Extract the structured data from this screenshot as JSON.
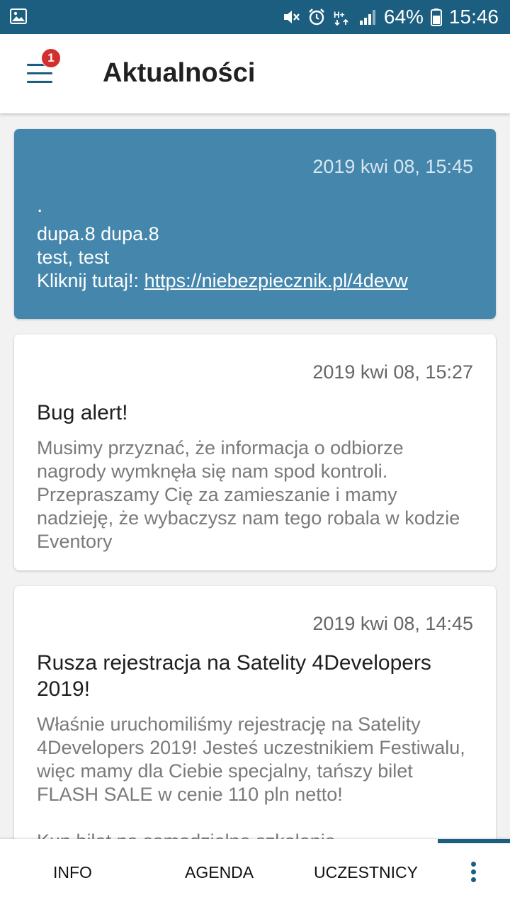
{
  "status_bar": {
    "battery": "64%",
    "time": "15:46",
    "icons": [
      "gallery-icon",
      "mute-icon",
      "alarm-icon",
      "hplus-network-icon",
      "signal-icon",
      "battery-icon"
    ]
  },
  "app_bar": {
    "title": "Aktualności",
    "menu_badge": "1"
  },
  "news": [
    {
      "date": "2019 kwi 08, 15:45",
      "title": ".",
      "lines": [
        "dupa.8 dupa.8",
        "test, test"
      ],
      "link_prefix": "Kliknij tutaj!: ",
      "link_text": "https://niebezpiecznik.pl/4devw",
      "highlighted": true
    },
    {
      "date": "2019 kwi 08, 15:27",
      "title": "Bug alert!",
      "body": "Musimy przyznać, że informacja o odbiorze nagrody wymknęła się nam spod kontroli. Przepraszamy Cię za zamieszanie i mamy nadzieję, że wybaczysz nam tego robala w kodzie Eventory"
    },
    {
      "date": "2019 kwi 08, 14:45",
      "title": "Rusza rejestracja na Satelity 4Developers 2019!",
      "body": "Właśnie uruchomiliśmy rejestrację na Satelity 4Developers 2019! Jesteś uczestnikiem Festiwalu, więc mamy dla Ciebie specjalny, tańszy bilet FLASH SALE w cenie 110 pln netto!",
      "body_cut": "Kup bilet na samodzielne szkolenia"
    }
  ],
  "bottom_nav": {
    "items": [
      "INFO",
      "AGENDA",
      "UCZESTNICY"
    ],
    "more_icon": "more-vert-icon"
  },
  "colors": {
    "primary": "#1b5e80",
    "highlight_card": "#4486ac",
    "badge": "#d32f2f"
  }
}
